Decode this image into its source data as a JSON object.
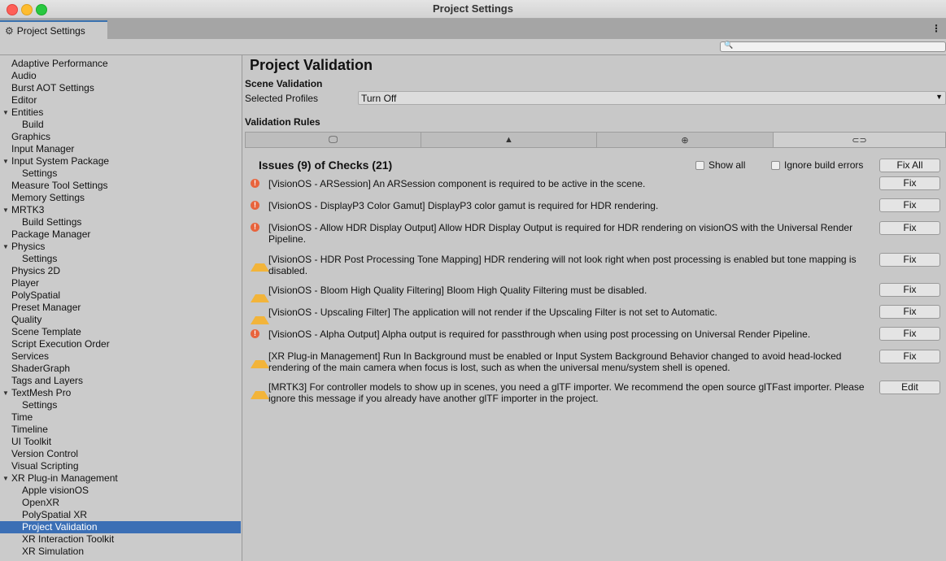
{
  "window": {
    "title": "Project Settings"
  },
  "tab": {
    "label": "Project Settings",
    "icon": "gear-icon"
  },
  "search": {
    "placeholder": "",
    "icon": "search-icon"
  },
  "sidebar": {
    "items": [
      {
        "label": "Adaptive Performance",
        "indent": 0
      },
      {
        "label": "Audio",
        "indent": 0
      },
      {
        "label": "Burst AOT Settings",
        "indent": 0
      },
      {
        "label": "Editor",
        "indent": 0
      },
      {
        "label": "Entities",
        "indent": 0,
        "expanded": true
      },
      {
        "label": "Build",
        "indent": 1
      },
      {
        "label": "Graphics",
        "indent": 0
      },
      {
        "label": "Input Manager",
        "indent": 0
      },
      {
        "label": "Input System Package",
        "indent": 0,
        "expanded": true
      },
      {
        "label": "Settings",
        "indent": 1
      },
      {
        "label": "Measure Tool Settings",
        "indent": 0
      },
      {
        "label": "Memory Settings",
        "indent": 0
      },
      {
        "label": "MRTK3",
        "indent": 0,
        "expanded": true
      },
      {
        "label": "Build Settings",
        "indent": 1
      },
      {
        "label": "Package Manager",
        "indent": 0
      },
      {
        "label": "Physics",
        "indent": 0,
        "expanded": true
      },
      {
        "label": "Settings",
        "indent": 1
      },
      {
        "label": "Physics 2D",
        "indent": 0
      },
      {
        "label": "Player",
        "indent": 0
      },
      {
        "label": "PolySpatial",
        "indent": 0
      },
      {
        "label": "Preset Manager",
        "indent": 0
      },
      {
        "label": "Quality",
        "indent": 0
      },
      {
        "label": "Scene Template",
        "indent": 0
      },
      {
        "label": "Script Execution Order",
        "indent": 0
      },
      {
        "label": "Services",
        "indent": 0
      },
      {
        "label": "ShaderGraph",
        "indent": 0
      },
      {
        "label": "Tags and Layers",
        "indent": 0
      },
      {
        "label": "TextMesh Pro",
        "indent": 0,
        "expanded": true
      },
      {
        "label": "Settings",
        "indent": 1
      },
      {
        "label": "Time",
        "indent": 0
      },
      {
        "label": "Timeline",
        "indent": 0
      },
      {
        "label": "UI Toolkit",
        "indent": 0
      },
      {
        "label": "Version Control",
        "indent": 0
      },
      {
        "label": "Visual Scripting",
        "indent": 0
      },
      {
        "label": "XR Plug-in Management",
        "indent": 0,
        "expanded": true
      },
      {
        "label": "Apple visionOS",
        "indent": 1
      },
      {
        "label": "OpenXR",
        "indent": 1
      },
      {
        "label": "PolySpatial XR",
        "indent": 1
      },
      {
        "label": "Project Validation",
        "indent": 1,
        "selected": true
      },
      {
        "label": "XR Interaction Toolkit",
        "indent": 1
      },
      {
        "label": "XR Simulation",
        "indent": 1
      }
    ]
  },
  "main": {
    "title": "Project Validation",
    "scene_validation_label": "Scene Validation",
    "selected_profiles_label": "Selected Profiles",
    "selected_profiles_value": "Turn Off",
    "validation_rules_label": "Validation Rules",
    "platform_tabs": [
      {
        "icon": "monitor-icon",
        "glyph": "🖵",
        "active": false
      },
      {
        "icon": "android-icon",
        "glyph": "▲",
        "active": false
      },
      {
        "icon": "globe-icon",
        "glyph": "⊕",
        "active": false
      },
      {
        "icon": "vr-headset-icon",
        "glyph": "⊂⊃",
        "active": true
      }
    ],
    "issues_header": "Issues (9) of Checks (21)",
    "show_all_label": "Show all",
    "ignore_build_errors_label": "Ignore build errors",
    "fix_all_label": "Fix All",
    "issues": [
      {
        "type": "error",
        "text": "[VisionOS - ARSession] An ARSession component is required to be active in the scene.",
        "action": "Fix"
      },
      {
        "type": "error",
        "text": "[VisionOS - DisplayP3 Color Gamut] DisplayP3 color gamut is required for HDR rendering.",
        "action": "Fix"
      },
      {
        "type": "error",
        "text": "[VisionOS - Allow HDR Display Output] Allow HDR Display Output is required for HDR rendering on visionOS with the Universal Render Pipeline.",
        "action": "Fix"
      },
      {
        "type": "warning",
        "text": "[VisionOS - HDR Post Processing Tone Mapping] HDR rendering will not look right when post processing is enabled but tone mapping is disabled.",
        "action": "Fix"
      },
      {
        "type": "warning",
        "text": "[VisionOS - Bloom High Quality Filtering] Bloom High Quality Filtering must be disabled.",
        "action": "Fix"
      },
      {
        "type": "warning",
        "text": "[VisionOS - Upscaling Filter] The application will not render if the Upscaling Filter is not set to Automatic.",
        "action": "Fix"
      },
      {
        "type": "error",
        "text": "[VisionOS - Alpha Output] Alpha output is required for passthrough when using post processing on Universal Render Pipeline.",
        "action": "Fix"
      },
      {
        "type": "warning",
        "text": "[XR Plug-in Management] Run In Background must be enabled or Input System Background Behavior changed to avoid head-locked rendering of the main camera when focus is lost, such as when the universal menu/system shell is opened.",
        "action": "Fix"
      },
      {
        "type": "warning",
        "text": "[MRTK3] For controller models to show up in scenes, you need a glTF importer. We recommend the open source glTFast importer. Please ignore this message if you already have another glTF importer in the project.",
        "action": "Edit"
      }
    ]
  }
}
